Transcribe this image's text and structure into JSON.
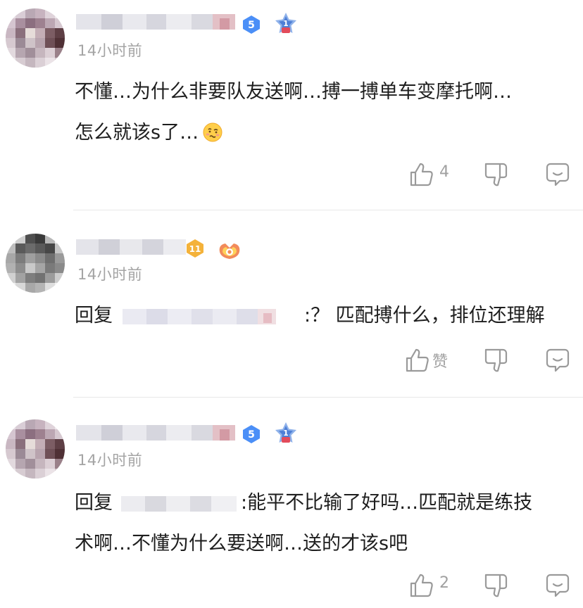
{
  "comments": [
    {
      "time": "14小时前",
      "text_line1": "不懂…为什么非要队友送啊…搏一搏单车变摩托啊…",
      "text_line2": "怎么就该s了…",
      "emoji": "woozy-face",
      "level": "5",
      "like_count": "4"
    },
    {
      "time": "14小时前",
      "reply_prefix": "回复",
      "text_after_mention": ":？ 匹配搏什么，排位还理解",
      "level": "11",
      "like_label": "赞"
    },
    {
      "time": "14小时前",
      "reply_prefix": "回复",
      "text_after_mention": ":能平不比输了好吗…匹配就是练技",
      "text_line2": "术啊…不懂为什么要送啊…送的才该s吧",
      "level": "5",
      "like_count": "2"
    }
  ],
  "colors": {
    "text": "#1e1e1e",
    "secondary": "#a4a4a4",
    "icon": "#9a9a9a",
    "level_blue": "#4b8ff7",
    "level_gold": "#f4b23a",
    "divider": "#e8e8e8"
  },
  "icons": [
    "thumbs-up-icon",
    "thumbs-down-icon",
    "reply-bubble-icon",
    "level-badge-icon",
    "medal-icon"
  ]
}
